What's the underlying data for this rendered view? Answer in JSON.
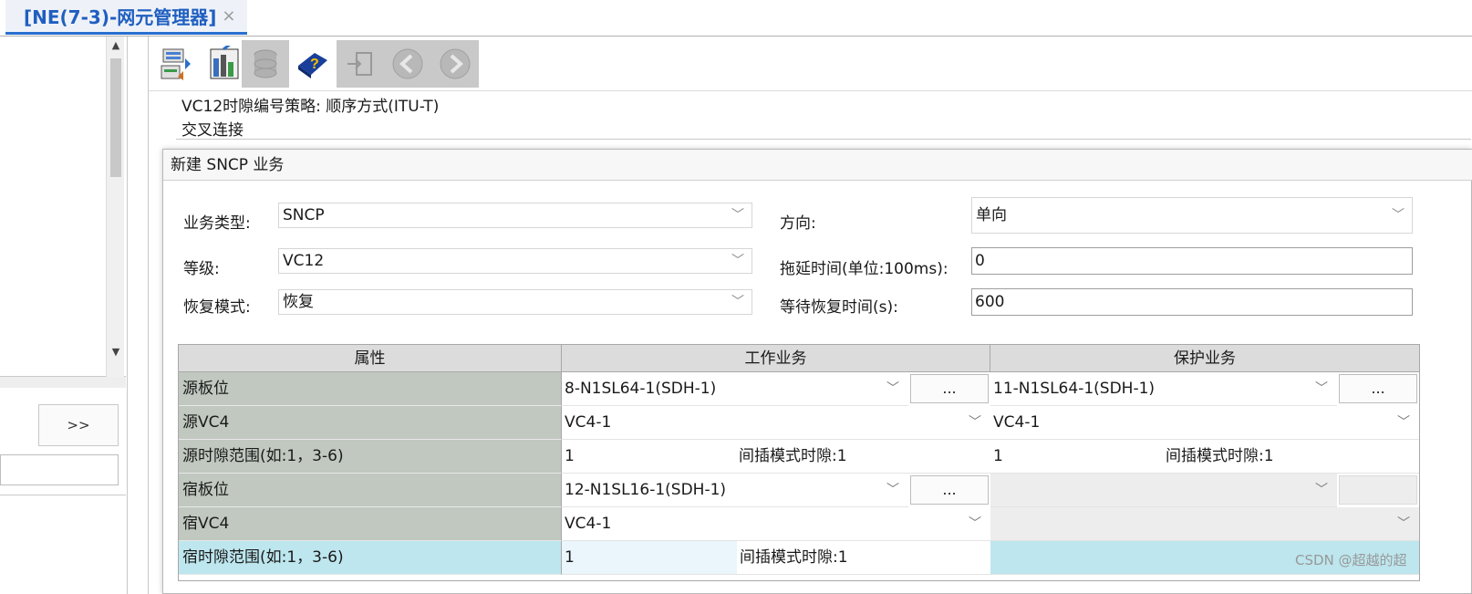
{
  "tab": {
    "title": "[NE(7-3)-网元管理器]",
    "close": "×"
  },
  "left": {
    "expand_label": ">>"
  },
  "main": {
    "strategy_label": "VC12时隙编号策略:",
    "strategy_value": "顺序方式(ITU-T)",
    "cross_label": "交叉连接"
  },
  "dialog": {
    "title": "新建 SNCP 业务",
    "fields": {
      "service_type_label": "业务类型:",
      "service_type_value": "SNCP",
      "direction_label": "方向:",
      "direction_value": "单向",
      "level_label": "等级:",
      "level_value": "VC12",
      "hold_off_label": "拖延时间(单位:100ms):",
      "hold_off_value": "0",
      "revert_label": "恢复模式:",
      "revert_value": "恢复",
      "wtr_label": "等待恢复时间(s):",
      "wtr_value": "600"
    },
    "table": {
      "headers": [
        "属性",
        "工作业务",
        "保护业务"
      ],
      "rows": {
        "src_board": {
          "label": "源板位",
          "work": "8-N1SL64-1(SDH-1)",
          "protect": "11-N1SL64-1(SDH-1)",
          "dots": "..."
        },
        "src_vc4": {
          "label": "源VC4",
          "work": "VC4-1",
          "protect": "VC4-1"
        },
        "src_ts": {
          "label": "源时隙范围(如:1，3-6)",
          "work": "1",
          "work_interleave": "间插模式时隙:1",
          "protect": "1",
          "protect_interleave": "间插模式时隙:1"
        },
        "sink_board": {
          "label": "宿板位",
          "work": "12-N1SL16-1(SDH-1)",
          "dots": "..."
        },
        "sink_vc4": {
          "label": "宿VC4",
          "work": "VC4-1"
        },
        "sink_ts": {
          "label": "宿时隙范围(如:1，3-6)",
          "work": "1",
          "work_interleave": "间插模式时隙:1"
        }
      }
    }
  },
  "watermark": "CSDN @超越的超",
  "icons": [
    "network-config-icon",
    "board-view-icon",
    "database-icon",
    "help-book-icon",
    "login-icon",
    "back-icon",
    "forward-icon"
  ]
}
